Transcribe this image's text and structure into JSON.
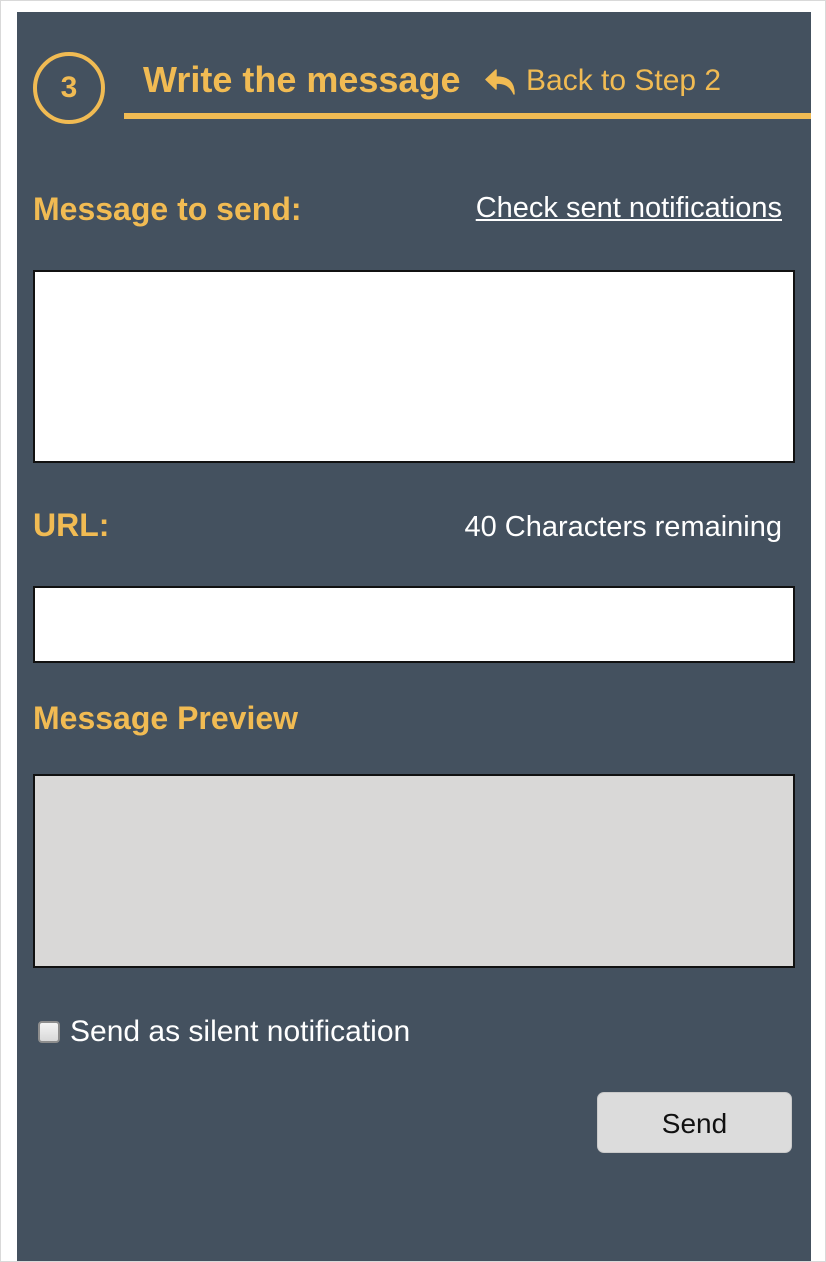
{
  "header": {
    "step_number": "3",
    "title": "Write the message",
    "back_link": "Back to Step 2",
    "back_icon": "reply-arrow-icon"
  },
  "message": {
    "label": "Message to send:",
    "check_sent_link": "Check sent notifications",
    "value": "",
    "placeholder": ""
  },
  "url": {
    "label": "URL:",
    "chars_remaining": "40 Characters remaining",
    "value": "",
    "placeholder": ""
  },
  "preview": {
    "label": "Message Preview",
    "content": ""
  },
  "silent_notification": {
    "label": "Send as silent notification",
    "checked": false
  },
  "actions": {
    "send_label": "Send"
  },
  "colors": {
    "panel_background": "#44515f",
    "accent": "#f1bb53",
    "preview_background": "#d9d8d7"
  }
}
